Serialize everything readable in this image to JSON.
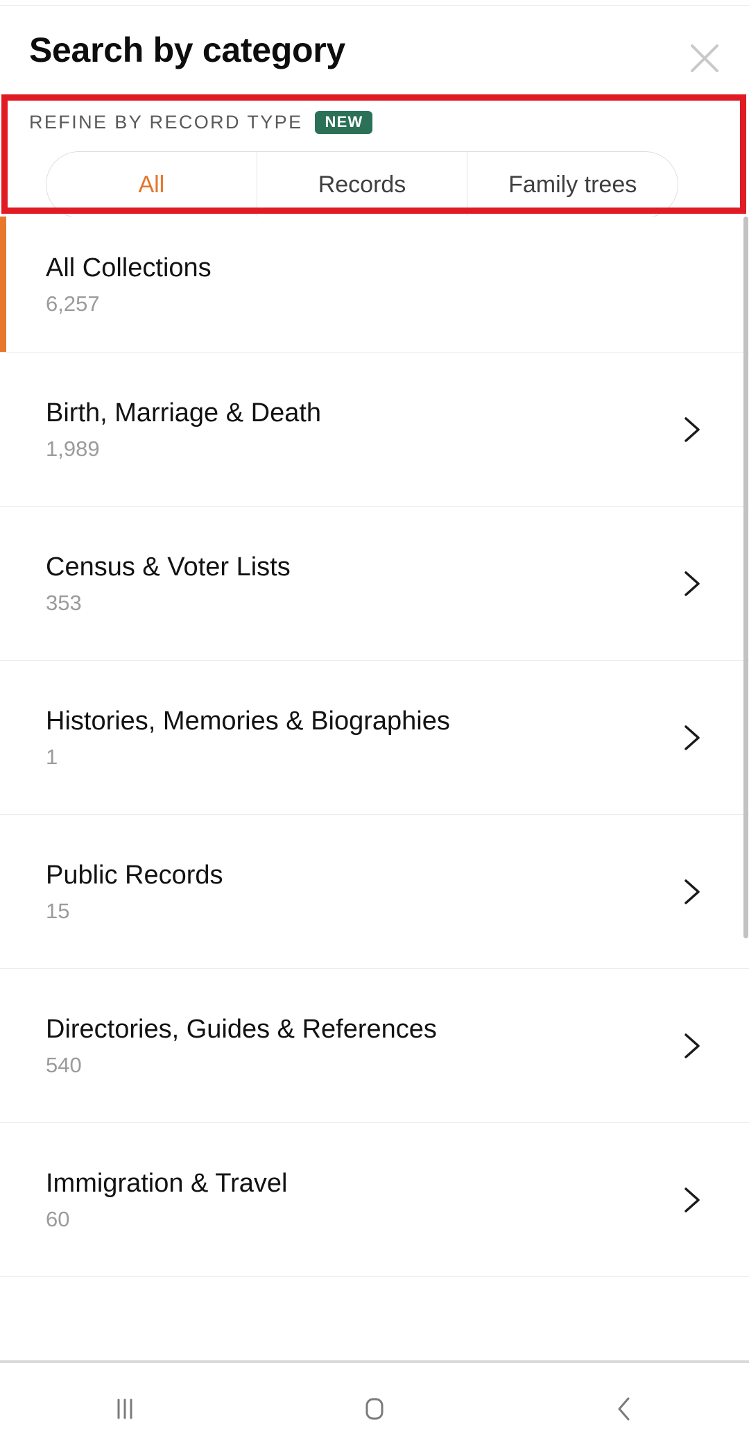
{
  "header": {
    "title": "Search by category",
    "close_icon": "close-icon"
  },
  "refine": {
    "label": "REFINE BY RECORD TYPE",
    "badge": "NEW",
    "badge_color": "#2b7158",
    "active_color": "#e4752b",
    "tabs": [
      {
        "label": "All",
        "active": true
      },
      {
        "label": "Records",
        "active": false
      },
      {
        "label": "Family trees",
        "active": false
      }
    ]
  },
  "annotation": {
    "color": "#e01b24"
  },
  "list": {
    "selected_indicator_color": "#e8772e",
    "items": [
      {
        "title": "All Collections",
        "count": "6,257",
        "selected": true,
        "chevron": false
      },
      {
        "title": "Birth, Marriage & Death",
        "count": "1,989",
        "selected": false,
        "chevron": true
      },
      {
        "title": "Census & Voter Lists",
        "count": "353",
        "selected": false,
        "chevron": true
      },
      {
        "title": "Histories, Memories & Biographies",
        "count": "1",
        "selected": false,
        "chevron": true
      },
      {
        "title": "Public Records",
        "count": "15",
        "selected": false,
        "chevron": true
      },
      {
        "title": "Directories, Guides & References",
        "count": "540",
        "selected": false,
        "chevron": true
      },
      {
        "title": "Immigration & Travel",
        "count": "60",
        "selected": false,
        "chevron": true
      }
    ]
  },
  "navbar": {
    "items": [
      {
        "name": "recents-icon"
      },
      {
        "name": "home-icon"
      },
      {
        "name": "back-icon"
      }
    ]
  }
}
